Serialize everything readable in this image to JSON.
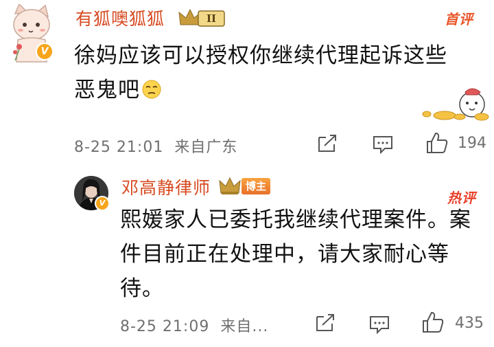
{
  "comment": {
    "username": "有狐噢狐狐",
    "level_badge": "II",
    "tag": "首评",
    "text": "徐妈应该可以授权你继续代理起诉这些恶鬼吧",
    "time": "8-25 21:01",
    "source": "来自广东",
    "likes": "194",
    "verified_mark": "V"
  },
  "reply": {
    "username": "邓高静律师",
    "author_badge": "博主",
    "tag": "热评",
    "text": "熙媛家人已委托我继续代理案件。案件目前正在处理中，请大家耐心等待。",
    "time": "8-25 21:09",
    "source": "来自...",
    "likes": "435",
    "verified_mark": "V"
  },
  "colors": {
    "username": "#d64a21",
    "meta_text": "#6f6f6f",
    "verified": "#f7a51c",
    "badge_gold": "#c89b3c"
  },
  "icons": [
    "share-icon",
    "comment-icon",
    "like-icon",
    "crown-icon",
    "pensive-emoji-icon"
  ]
}
